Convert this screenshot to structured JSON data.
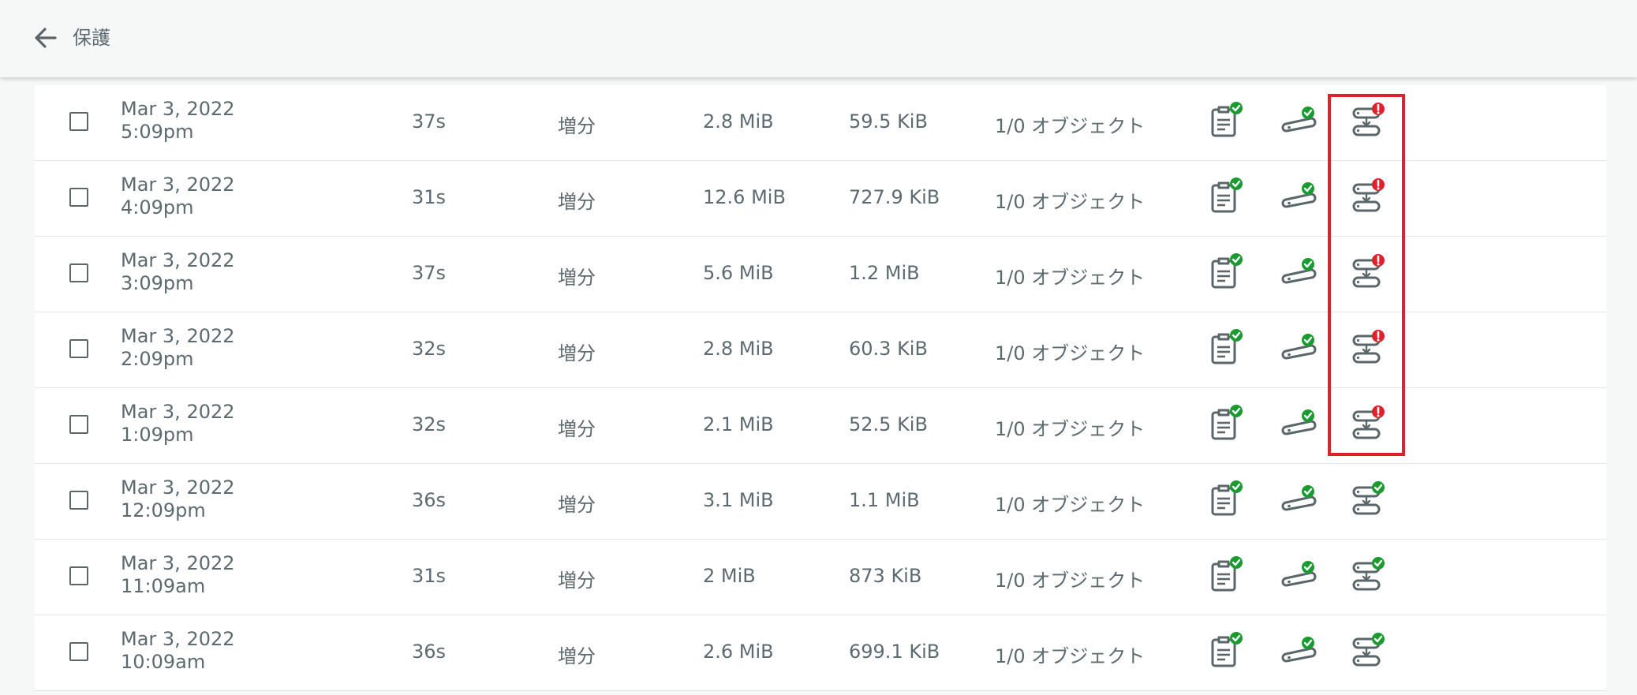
{
  "header": {
    "title": "保護",
    "back_icon": "arrow-left-icon"
  },
  "colors": {
    "accent_ok": "#1a9b2f",
    "error": "#e0202b",
    "text": "#5d6a70",
    "highlight": "#e0202b"
  },
  "rows": [
    {
      "date": "Mar 3, 2022",
      "time": "5:09pm",
      "duration": "37s",
      "type": "増分",
      "size": "2.8 MiB",
      "transferred": "59.5 KiB",
      "objects": "1/0 オブジェクト",
      "replication_status": "error"
    },
    {
      "date": "Mar 3, 2022",
      "time": "4:09pm",
      "duration": "31s",
      "type": "増分",
      "size": "12.6 MiB",
      "transferred": "727.9 KiB",
      "objects": "1/0 オブジェクト",
      "replication_status": "error"
    },
    {
      "date": "Mar 3, 2022",
      "time": "3:09pm",
      "duration": "37s",
      "type": "増分",
      "size": "5.6 MiB",
      "transferred": "1.2 MiB",
      "objects": "1/0 オブジェクト",
      "replication_status": "error"
    },
    {
      "date": "Mar 3, 2022",
      "time": "2:09pm",
      "duration": "32s",
      "type": "増分",
      "size": "2.8 MiB",
      "transferred": "60.3 KiB",
      "objects": "1/0 オブジェクト",
      "replication_status": "error"
    },
    {
      "date": "Mar 3, 2022",
      "time": "1:09pm",
      "duration": "32s",
      "type": "増分",
      "size": "2.1 MiB",
      "transferred": "52.5 KiB",
      "objects": "1/0 オブジェクト",
      "replication_status": "error"
    },
    {
      "date": "Mar 3, 2022",
      "time": "12:09pm",
      "duration": "36s",
      "type": "増分",
      "size": "3.1 MiB",
      "transferred": "1.1 MiB",
      "objects": "1/0 オブジェクト",
      "replication_status": "ok"
    },
    {
      "date": "Mar 3, 2022",
      "time": "11:09am",
      "duration": "31s",
      "type": "増分",
      "size": "2 MiB",
      "transferred": "873 KiB",
      "objects": "1/0 オブジェクト",
      "replication_status": "ok"
    },
    {
      "date": "Mar 3, 2022",
      "time": "10:09am",
      "duration": "36s",
      "type": "増分",
      "size": "2.6 MiB",
      "transferred": "699.1 KiB",
      "objects": "1/0 オブジェクト",
      "replication_status": "ok"
    }
  ]
}
